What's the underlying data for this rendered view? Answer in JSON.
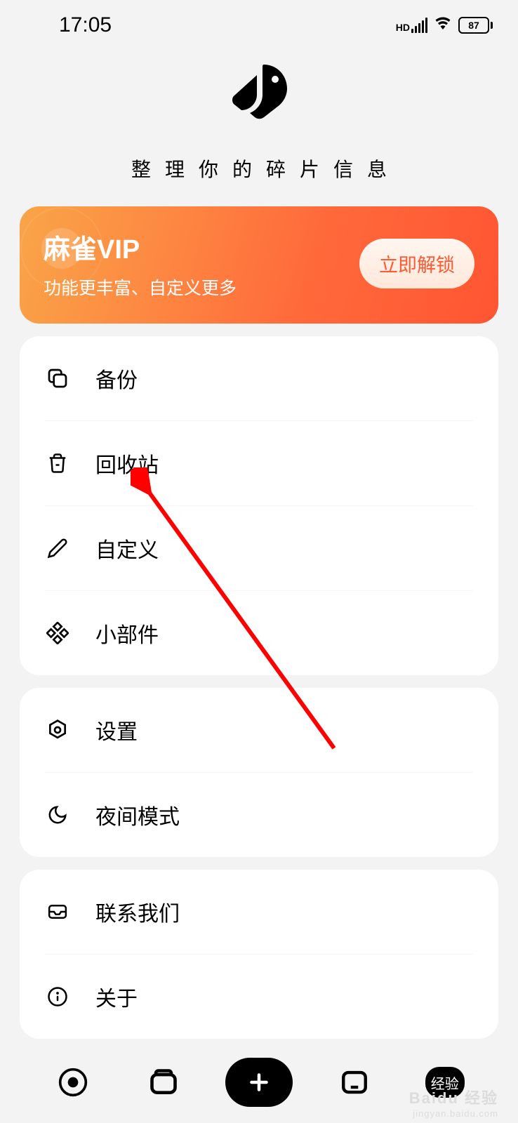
{
  "status": {
    "time": "17:05",
    "battery": "87",
    "hd_label": "HD"
  },
  "header": {
    "tagline": "整理你的碎片信息"
  },
  "vip": {
    "title": "麻雀VIP",
    "subtitle": "功能更丰富、自定义更多",
    "button": "立即解锁"
  },
  "menu": {
    "group1": [
      {
        "label": "备份",
        "icon": "copy-icon"
      },
      {
        "label": "回收站",
        "icon": "trash-icon"
      },
      {
        "label": "自定义",
        "icon": "pencil-icon"
      },
      {
        "label": "小部件",
        "icon": "widgets-icon"
      }
    ],
    "group2": [
      {
        "label": "设置",
        "icon": "settings-icon"
      },
      {
        "label": "夜间模式",
        "icon": "moon-icon"
      }
    ],
    "group3": [
      {
        "label": "联系我们",
        "icon": "inbox-icon"
      },
      {
        "label": "关于",
        "icon": "info-icon"
      }
    ]
  },
  "nav": {
    "badge": "经验"
  },
  "watermark": {
    "main": "Baidu 经验",
    "sub": "jingyan.baidu.com"
  }
}
